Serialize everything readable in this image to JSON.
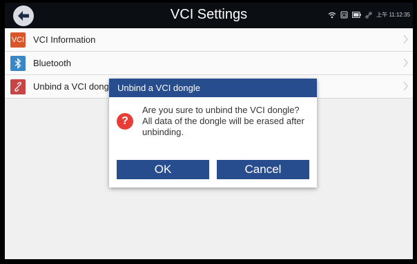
{
  "app": {
    "title": "VCI Settings",
    "status_time": "上午 11:12:35"
  },
  "list": {
    "items": [
      {
        "label": "VCI Information",
        "icon": "vci-icon",
        "icon_text": "VCI",
        "icon_color": "#d9552a"
      },
      {
        "label": "Bluetooth",
        "icon": "bluetooth-icon",
        "icon_color": "#3a87c8"
      },
      {
        "label": "Unbind a VCI dongle",
        "icon": "unlink-icon",
        "icon_color": "#c84545"
      }
    ]
  },
  "dialog": {
    "title": "Unbind a VCI dongle",
    "message": "Are you sure to unbind the VCI dongle? All data of the dongle will be erased after unbinding.",
    "ok_label": "OK",
    "cancel_label": "Cancel"
  },
  "colors": {
    "header_bg": "#0b0f14",
    "dialog_header": "#284d8f",
    "button": "#284d8f",
    "alert": "#e63d36"
  }
}
